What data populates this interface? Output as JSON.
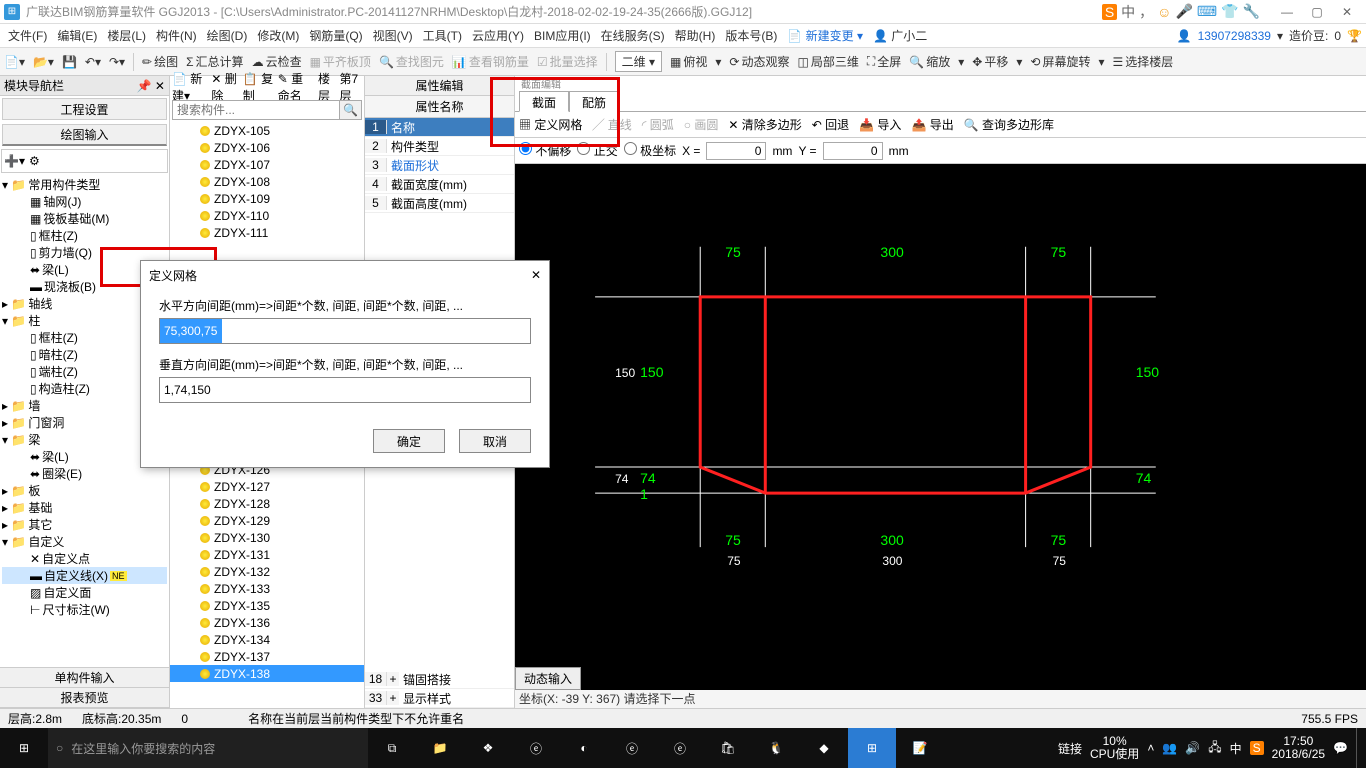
{
  "title": "广联达BIM钢筋算量软件 GGJ2013 - [C:\\Users\\Administrator.PC-20141127NRHM\\Desktop\\白龙村-2018-02-02-19-24-35(2666版).GGJ12]",
  "menubar": {
    "items": [
      "文件(F)",
      "编辑(E)",
      "楼层(L)",
      "构件(N)",
      "绘图(D)",
      "修改(M)",
      "钢筋量(Q)",
      "视图(V)",
      "工具(T)",
      "云应用(Y)",
      "BIM应用(I)",
      "在线服务(S)",
      "帮助(H)",
      "版本号(B)"
    ],
    "newchange": "新建变更",
    "user": "广小二",
    "phone": "13907298339",
    "beans_label": "造价豆:",
    "beans_value": "0"
  },
  "toolbar1": {
    "items": [
      "绘图",
      "汇总计算",
      "云检查",
      "平齐板顶",
      "查找图元",
      "查看钢筋量",
      "批量选择"
    ],
    "viewmode": "二维",
    "right": [
      "俯视",
      "动态观察",
      "局部三维",
      "全屏",
      "缩放",
      "平移",
      "屏幕旋转",
      "选择楼层"
    ]
  },
  "leftpanel": {
    "header": "模块导航栏",
    "tab1": "工程设置",
    "tab2": "绘图输入",
    "groups": {
      "common": "常用构件类型",
      "common_children": [
        "轴网(J)",
        "筏板基础(M)",
        "框柱(Z)",
        "剪力墙(Q)",
        "梁(L)",
        "现浇板(B)"
      ],
      "axis": "轴线",
      "col": "柱",
      "col_children": [
        "框柱(Z)",
        "暗柱(Z)",
        "端柱(Z)",
        "构造柱(Z)"
      ],
      "wall": "墙",
      "door": "门窗洞",
      "beam": "梁",
      "beam_children": [
        "梁(L)",
        "圈梁(E)"
      ],
      "slab": "板",
      "foundation": "基础",
      "other": "其它",
      "custom": "自定义",
      "custom_children": [
        "自定义点",
        "自定义线(X)",
        "自定义面",
        "尺寸标注(W)"
      ]
    },
    "foot1": "单构件输入",
    "foot2": "报表预览"
  },
  "midpanel": {
    "toolbar": [
      "新建",
      "删除",
      "复制",
      "重命名",
      "楼层",
      "第7层"
    ],
    "search_placeholder": "搜索构件...",
    "items_top": [
      "ZDYX-105",
      "ZDYX-106",
      "ZDYX-107",
      "ZDYX-108",
      "ZDYX-109",
      "ZDYX-110",
      "ZDYX-111"
    ],
    "items_bottom": [
      "ZDYX-126",
      "ZDYX-127",
      "ZDYX-128",
      "ZDYX-129",
      "ZDYX-130",
      "ZDYX-131",
      "ZDYX-132",
      "ZDYX-133",
      "ZDYX-135",
      "ZDYX-136",
      "ZDYX-134",
      "ZDYX-137",
      "ZDYX-138"
    ],
    "selected": "ZDYX-138"
  },
  "proppanel": {
    "title": "属性编辑",
    "col": "属性名称",
    "rows": [
      {
        "n": "1",
        "v": "名称",
        "sel": true
      },
      {
        "n": "2",
        "v": "构件类型"
      },
      {
        "n": "3",
        "v": "截面形状",
        "blue": true
      },
      {
        "n": "4",
        "v": "截面宽度(mm)"
      },
      {
        "n": "5",
        "v": "截面高度(mm)"
      }
    ],
    "rows_bottom": [
      {
        "n": "18",
        "v": "锚固搭接",
        "exp": "+"
      },
      {
        "n": "33",
        "v": "显示样式",
        "exp": "+"
      }
    ]
  },
  "canvaspanel": {
    "mini_title": "截面编辑",
    "tabs": [
      "截面",
      "配筋"
    ],
    "toolbar": [
      "定义网格",
      "直线",
      "圆弧",
      "画圆",
      "清除多边形",
      "回退",
      "导入",
      "导出",
      "查询多边形库"
    ],
    "radios": [
      "不偏移",
      "正交",
      "极坐标"
    ],
    "xlabel": "X =",
    "xval": "0",
    "xunit": "mm",
    "ylabel": "Y =",
    "yval": "0",
    "yunit": "mm",
    "dims_top": [
      "75",
      "300",
      "75"
    ],
    "dims_left": [
      "150",
      "74",
      "1"
    ],
    "dims_right": [
      "150",
      "74"
    ],
    "dims_bottom_g": [
      "75",
      "300",
      "75"
    ],
    "dims_bottom_w": [
      "75",
      "300",
      "75"
    ],
    "dyn_input": "动态输入",
    "status": "坐标(X: -39 Y: 367) 请选择下一点"
  },
  "dialog": {
    "title": "定义网格",
    "h_label": "水平方向间距(mm)=>间距*个数, 间距, 间距*个数, 间距, ...",
    "h_value": "75,300,75",
    "v_label": "垂直方向间距(mm)=>间距*个数, 间距, 间距*个数, 间距, ...",
    "v_value": "1,74,150",
    "ok": "确定",
    "cancel": "取消"
  },
  "appstatus": {
    "layer_h": "层高:2.8m",
    "bottom_h": "底标高:20.35m",
    "o": "0",
    "prop": "名称在当前层当前构件类型下不允许重名",
    "fps": "755.5 FPS"
  },
  "taskbar": {
    "search": "在这里输入你要搜索的内容",
    "link": "链接",
    "cpu_pct": "10%",
    "cpu_lbl": "CPU使用",
    "ime": "中",
    "sogou": "S",
    "time": "17:50",
    "date": "2018/6/25"
  },
  "ime_top": {
    "s": "S",
    "zh": "中"
  }
}
